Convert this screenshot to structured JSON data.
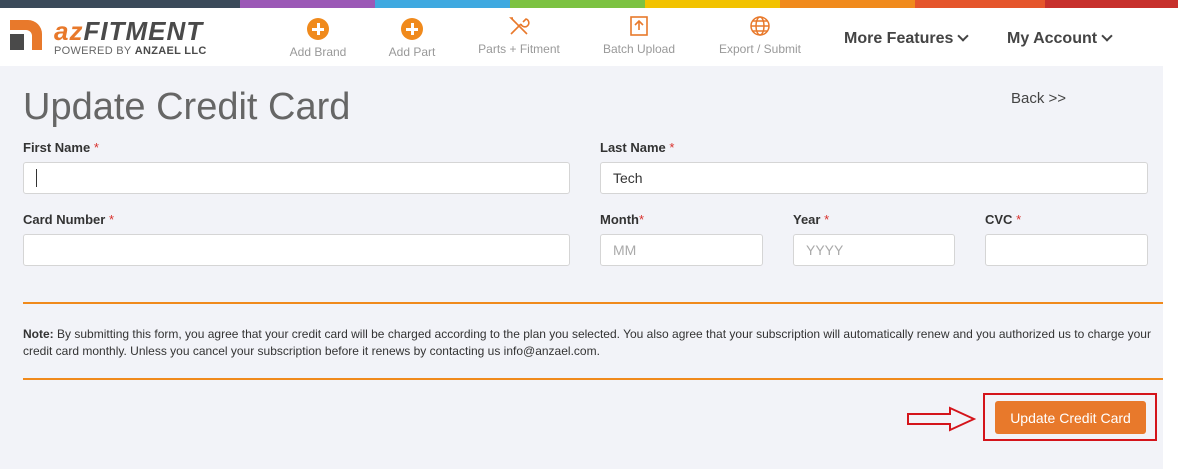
{
  "colorbar": [
    "#3b4a5a",
    "#9b59b6",
    "#3fa9e0",
    "#7cc242",
    "#f2c200",
    "#f08a1c",
    "#e5552b",
    "#c7302c"
  ],
  "brand": {
    "name_a": "az",
    "name_b": "FITMENT",
    "powered_prefix": "POWERED BY",
    "powered_company": "ANZAEL LLC"
  },
  "nav": {
    "items": [
      {
        "label": "Add Brand",
        "icon": "plus-circle-icon"
      },
      {
        "label": "Add Part",
        "icon": "plus-circle-icon"
      },
      {
        "label": "Parts + Fitment",
        "icon": "tools-icon"
      },
      {
        "label": "Batch Upload",
        "icon": "upload-icon"
      },
      {
        "label": "Export / Submit",
        "icon": "globe-icon"
      }
    ],
    "more_features": "More Features",
    "my_account": "My Account"
  },
  "page": {
    "title": "Update Credit Card",
    "back": "Back >>"
  },
  "form": {
    "first_name": {
      "label": "First Name",
      "value": "",
      "placeholder": ""
    },
    "last_name": {
      "label": "Last Name",
      "value": "Tech",
      "placeholder": ""
    },
    "card_number": {
      "label": "Card Number",
      "value": "",
      "placeholder": ""
    },
    "month": {
      "label": "Month",
      "value": "",
      "placeholder": "MM"
    },
    "year": {
      "label": "Year",
      "value": "",
      "placeholder": "YYYY"
    },
    "cvc": {
      "label": "CVC",
      "value": "",
      "placeholder": ""
    },
    "required_mark": "*"
  },
  "note": {
    "label": "Note:",
    "text": " By submitting this form, you agree that your credit card will be charged according to the plan you selected. You also agree that your subscription will automatically renew and you authorized us to charge your credit card monthly. Unless you cancel your subscription before it renews by contacting us info@anzael.com."
  },
  "submit_label": "Update Credit Card"
}
